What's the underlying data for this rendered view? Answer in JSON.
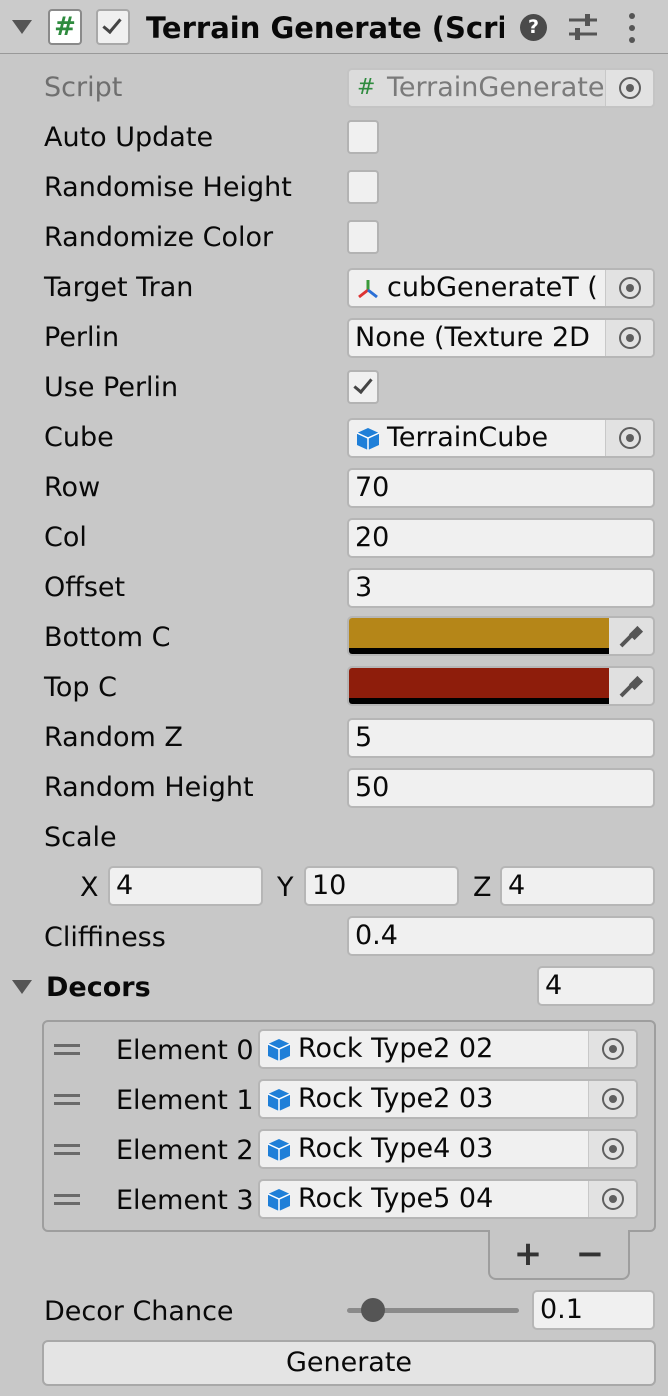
{
  "header": {
    "script_icon": "#",
    "title": "Terrain Generate (Script)",
    "help_icon": "?",
    "icons": [
      "foldout-arrow-icon",
      "script-icon",
      "checkbox-icon",
      "help-icon",
      "settings-icon",
      "menu-icon"
    ]
  },
  "script_field": {
    "label": "Script",
    "icon": "#",
    "value": "TerrainGenerate"
  },
  "auto_update": {
    "label": "Auto Update",
    "checked": false
  },
  "randomise_height": {
    "label": "Randomise Height",
    "checked": false
  },
  "randomize_color": {
    "label": "Randomize Color",
    "checked": false
  },
  "target_tran": {
    "label": "Target Tran",
    "value": "cubGenerateT ("
  },
  "perlin": {
    "label": "Perlin",
    "value": "None (Texture 2D"
  },
  "use_perlin": {
    "label": "Use Perlin",
    "checked": true
  },
  "cube": {
    "label": "Cube",
    "value": "TerrainCube"
  },
  "row": {
    "label": "Row",
    "value": "70"
  },
  "col": {
    "label": "Col",
    "value": "20"
  },
  "offset": {
    "label": "Offset",
    "value": "3"
  },
  "bottom_c": {
    "label": "Bottom C",
    "color": "#b58618"
  },
  "top_c": {
    "label": "Top C",
    "color": "#8e1d0b"
  },
  "random_z": {
    "label": "Random Z",
    "value": "5"
  },
  "random_height": {
    "label": "Random Height",
    "value": "50"
  },
  "scale": {
    "label": "Scale",
    "x_label": "X",
    "x": "4",
    "y_label": "Y",
    "y": "10",
    "z_label": "Z",
    "z": "4"
  },
  "cliffiness": {
    "label": "Cliffiness",
    "value": "0.4"
  },
  "decors": {
    "label": "Decors",
    "size": "4",
    "items": [
      {
        "label": "Element 0",
        "value": "Rock Type2 02"
      },
      {
        "label": "Element 1",
        "value": "Rock Type2 03"
      },
      {
        "label": "Element 2",
        "value": "Rock Type4 03"
      },
      {
        "label": "Element 3",
        "value": "Rock Type5 04"
      }
    ],
    "add_label": "+",
    "remove_label": "−"
  },
  "decor_chance": {
    "label": "Decor Chance",
    "value": "0.1",
    "slider_fraction": 0.1
  },
  "generate_button": {
    "label": "Generate"
  },
  "colors": {
    "background": "#c8c8c8",
    "field": "#f0f0f0",
    "cube_icon": "#1f7fd8"
  }
}
